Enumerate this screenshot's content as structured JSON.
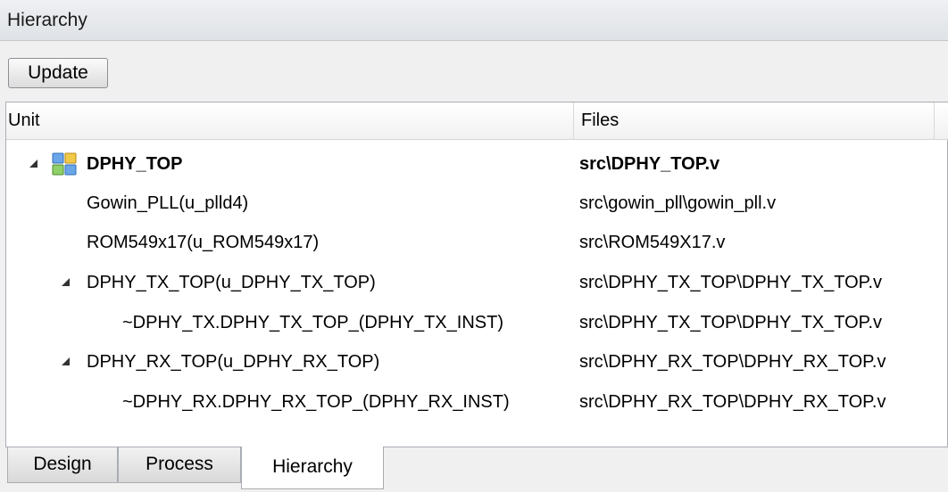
{
  "panel": {
    "title": "Hierarchy"
  },
  "toolbar": {
    "update_label": "Update"
  },
  "columns": {
    "unit": "Unit",
    "files": "Files"
  },
  "rows": [
    {
      "unit": "DPHY_TOP",
      "file": "src\\DPHY_TOP.v",
      "bold": true,
      "expanded": true,
      "icon": "module-icon"
    },
    {
      "unit": "Gowin_PLL(u_plld4)",
      "file": "src\\gowin_pll\\gowin_pll.v"
    },
    {
      "unit": "ROM549x17(u_ROM549x17)",
      "file": "src\\ROM549X17.v"
    },
    {
      "unit": "DPHY_TX_TOP(u_DPHY_TX_TOP)",
      "file": "src\\DPHY_TX_TOP\\DPHY_TX_TOP.v",
      "expanded": true
    },
    {
      "unit": "~DPHY_TX.DPHY_TX_TOP_(DPHY_TX_INST)",
      "file": "src\\DPHY_TX_TOP\\DPHY_TX_TOP.v"
    },
    {
      "unit": "DPHY_RX_TOP(u_DPHY_RX_TOP)",
      "file": "src\\DPHY_RX_TOP\\DPHY_RX_TOP.v",
      "expanded": true
    },
    {
      "unit": "~DPHY_RX.DPHY_RX_TOP_(DPHY_RX_INST)",
      "file": "src\\DPHY_RX_TOP\\DPHY_RX_TOP.v"
    }
  ],
  "tabs": [
    {
      "label": "Design"
    },
    {
      "label": "Process"
    },
    {
      "label": "Hierarchy",
      "active": true
    }
  ]
}
